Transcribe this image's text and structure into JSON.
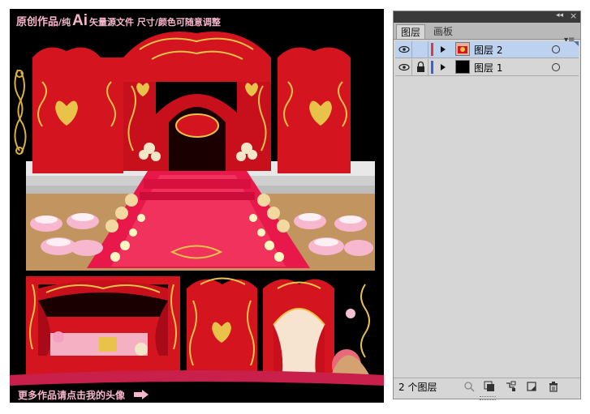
{
  "artwork": {
    "banner_main": "原创作品",
    "banner_slash1": "/纯",
    "banner_ai": "Ai",
    "banner_rest": "矢量源文件 尺寸/颜色可随意调整",
    "footer": "更多作品请点击我的头像"
  },
  "layers_panel": {
    "tabs": [
      {
        "label": "图层",
        "active": true
      },
      {
        "label": "画板",
        "active": false
      }
    ],
    "collapse_icon": "double-chevron-left-icon",
    "close_icon": "close-icon",
    "menu_icon": "panel-menu-icon",
    "layers": [
      {
        "name": "图层 2",
        "visible": true,
        "locked": false,
        "selected": true,
        "color": "#e23a3a"
      },
      {
        "name": "图层 1",
        "visible": true,
        "locked": true,
        "selected": false,
        "color": "#3a5fe2"
      }
    ],
    "layer_count": "2 个图层",
    "bottom_icons": [
      "locate-object-icon",
      "make-clipping-mask-icon",
      "create-sublayer-icon",
      "new-layer-icon",
      "delete-icon"
    ]
  }
}
